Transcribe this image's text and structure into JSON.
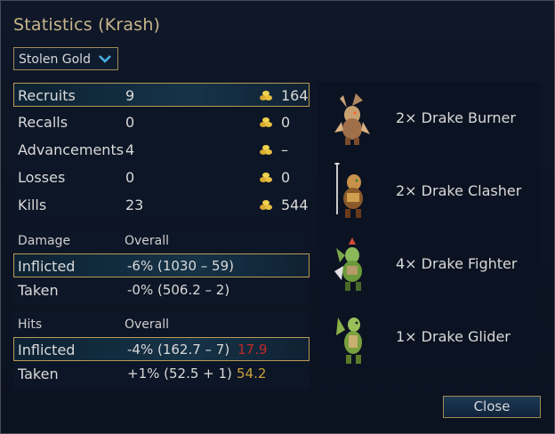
{
  "title": "Statistics (Krash)",
  "dropdown": {
    "selected": "Stolen Gold"
  },
  "summary": [
    {
      "label": "Recruits",
      "count": "9",
      "gold": "164"
    },
    {
      "label": "Recalls",
      "count": "0",
      "gold": "0"
    },
    {
      "label": "Advancements",
      "count": "4",
      "gold": "–"
    },
    {
      "label": "Losses",
      "count": "0",
      "gold": "0"
    },
    {
      "label": "Kills",
      "count": "23",
      "gold": "544"
    }
  ],
  "damage": {
    "header": "Damage",
    "overall": "Overall",
    "inflicted_label": "Inflicted",
    "inflicted_value": "-6% (1030 – 59)",
    "taken_label": "Taken",
    "taken_value": "-0% (506.2 – 2)"
  },
  "hits": {
    "header": "Hits",
    "overall": "Overall",
    "inflicted_label": "Inflicted",
    "inflicted_value": "-4% (162.7 – 7)",
    "inflicted_extra": "17.9",
    "taken_label": "Taken",
    "taken_value": "+1% (52.5 + 1)",
    "taken_extra": "54.2"
  },
  "units": [
    {
      "name": "2× Drake Burner",
      "icon": "drake-burner-icon"
    },
    {
      "name": "2× Drake Clasher",
      "icon": "drake-clasher-icon"
    },
    {
      "name": "4× Drake Fighter",
      "icon": "drake-fighter-icon"
    },
    {
      "name": "1× Drake Glider",
      "icon": "drake-glider-icon"
    }
  ],
  "close_label": "Close",
  "colors": {
    "accent_gold": "#b99a55",
    "negative_red": "#c02a2a",
    "highlight_yellow": "#c8a23a",
    "title": "#c8b68a"
  }
}
